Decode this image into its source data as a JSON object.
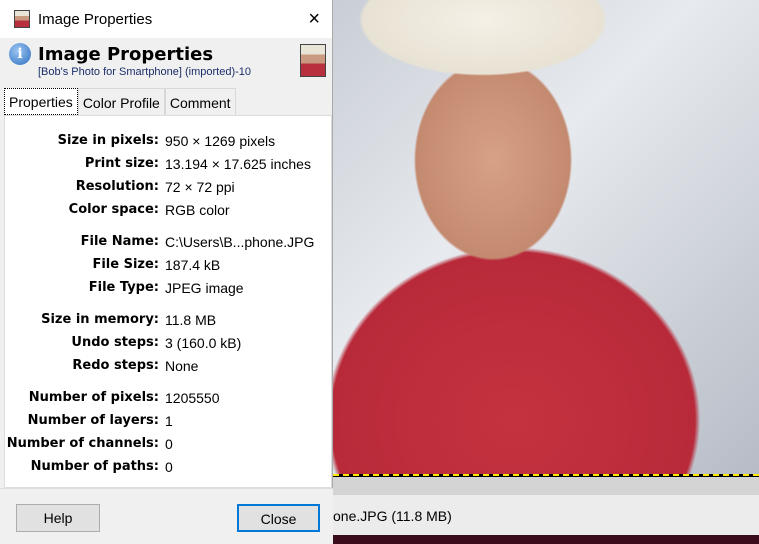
{
  "window": {
    "title": "Image Properties",
    "close_icon": "×"
  },
  "header": {
    "title": "Image Properties",
    "subtitle": "[Bob's Photo for Smartphone] (imported)-10",
    "info_icon": "i"
  },
  "tabs": [
    "Properties",
    "Color Profile",
    "Comment"
  ],
  "properties": [
    {
      "label": "Size in pixels:",
      "value": "950 × 1269 pixels"
    },
    {
      "label": "Print size:",
      "value": "13.194 × 17.625 inches"
    },
    {
      "label": "Resolution:",
      "value": "72 × 72 ppi"
    },
    {
      "label": "Color space:",
      "value": "RGB color"
    },
    {
      "label": "File Name:",
      "value": "C:\\Users\\B...phone.JPG"
    },
    {
      "label": "File Size:",
      "value": "187.4 kB"
    },
    {
      "label": "File Type:",
      "value": "JPEG image"
    },
    {
      "label": "Size in memory:",
      "value": "11.8 MB"
    },
    {
      "label": "Undo steps:",
      "value": "3 (160.0 kB)"
    },
    {
      "label": "Redo steps:",
      "value": "None"
    },
    {
      "label": "Number of pixels:",
      "value": "1205550"
    },
    {
      "label": "Number of layers:",
      "value": "1"
    },
    {
      "label": "Number of channels:",
      "value": "0"
    },
    {
      "label": "Number of paths:",
      "value": "0"
    }
  ],
  "buttons": {
    "help": "Help",
    "close": "Close"
  },
  "background": {
    "status_text": "one.JPG (11.8 MB)"
  }
}
